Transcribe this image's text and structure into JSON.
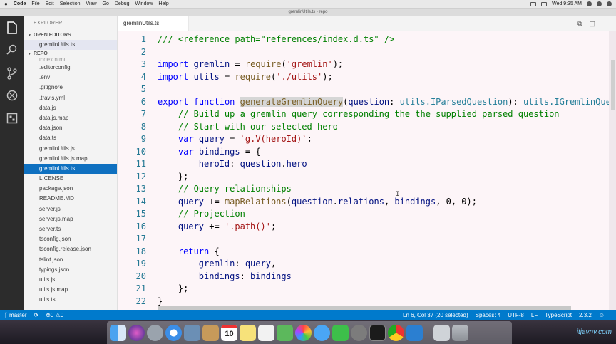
{
  "menubar": {
    "apple": "",
    "app": "Code",
    "items": [
      "File",
      "Edit",
      "Selection",
      "View",
      "Go",
      "Debug",
      "Window",
      "Help"
    ],
    "clock": "Wed 9:35 AM"
  },
  "window": {
    "title": "gremlinUtils.ts - repo"
  },
  "sidebar": {
    "title": "EXPLORER",
    "open_editors_label": "OPEN EDITORS",
    "open_editors": [
      "gremlinUtils.ts"
    ],
    "repo_label": "REPO",
    "files": [
      "index.html",
      ".editorconfig",
      ".env",
      ".gitignore",
      ".travis.yml",
      "data.js",
      "data.js.map",
      "data.json",
      "data.ts",
      "gremlinUtils.js",
      "gremlinUtils.js.map",
      "gremlinUtils.ts",
      "LICENSE",
      "package.json",
      "README.MD",
      "server.js",
      "server.js.map",
      "server.ts",
      "tsconfig.json",
      "tsconfig.release.json",
      "tslint.json",
      "typings.json",
      "utils.js",
      "utils.js.map",
      "utils.ts"
    ],
    "selected_file": "gremlinUtils.ts"
  },
  "editor": {
    "tab_label": "gremlinUtils.ts",
    "line_numbers": [
      "1",
      "2",
      "3",
      "4",
      "5",
      "6",
      "7",
      "8",
      "9",
      "10",
      "11",
      "12",
      "13",
      "14",
      "15",
      "16",
      "17",
      "18",
      "19",
      "20",
      "21",
      "22",
      "23"
    ],
    "cursor_glyph": "I"
  },
  "statusbar": {
    "branch": "master",
    "sync": "⟳",
    "problems": "⊗0 ⚠0",
    "position": "Ln 6, Col 37 (20 selected)",
    "indent": "Spaces: 4",
    "encoding": "UTF-8",
    "eol": "LF",
    "language": "TypeScript",
    "version": "2.3.2"
  },
  "dock": {
    "calendar_day": "10",
    "watermark": "itjavnv.com"
  },
  "colors": {
    "accent": "#007acc",
    "selection": "#0e70c0"
  }
}
